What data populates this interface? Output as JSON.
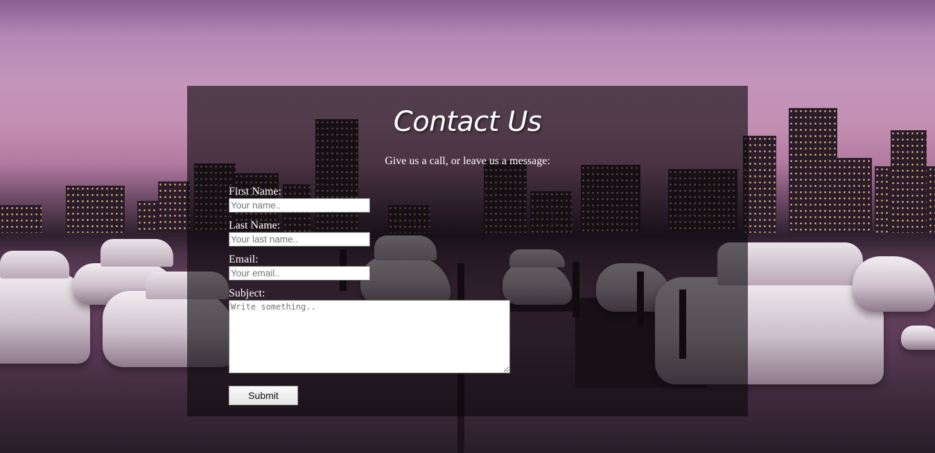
{
  "contact": {
    "title": "Contact Us",
    "tagline": "Give us a call, or leave us a message:"
  },
  "form": {
    "first_name": {
      "label": "First Name:",
      "placeholder": "Your name.."
    },
    "last_name": {
      "label": "Last Name:",
      "placeholder": "Your last name.."
    },
    "email": {
      "label": "Email:",
      "placeholder": "Your email.."
    },
    "subject": {
      "label": "Subject:",
      "placeholder": "Write something.."
    },
    "submit_label": "Submit"
  }
}
